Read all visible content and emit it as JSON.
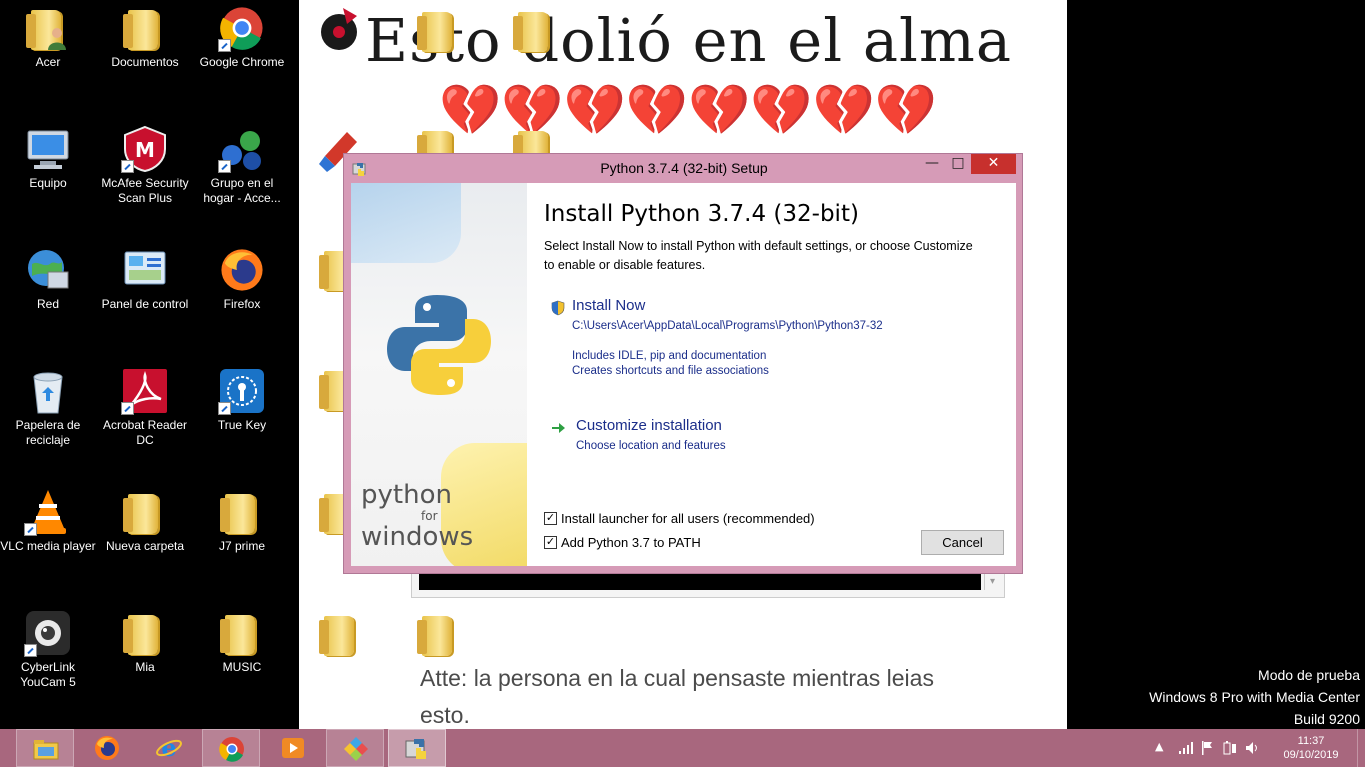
{
  "wallpaper": {
    "title": "Esto dolió en el alma",
    "hearts": "💔💔💔💔💔💔💔💔",
    "message": "Atte: la persona en la cual pensaste mientras leias esto."
  },
  "desktop_icons": [
    {
      "label": "Acer",
      "icon": "user-folder-icon"
    },
    {
      "label": "Documentos",
      "icon": "folder-icon"
    },
    {
      "label": "Google Chrome",
      "icon": "chrome-icon"
    },
    {
      "label": "Equipo",
      "icon": "computer-icon"
    },
    {
      "label": "McAfee Security Scan Plus",
      "icon": "mcafee-icon"
    },
    {
      "label": "Grupo en el hogar - Acce...",
      "icon": "homegroup-icon"
    },
    {
      "label": "Red",
      "icon": "network-icon"
    },
    {
      "label": "Panel de control",
      "icon": "control-panel-icon"
    },
    {
      "label": "Firefox",
      "icon": "firefox-icon"
    },
    {
      "label": "Papelera de reciclaje",
      "icon": "recycle-bin-icon"
    },
    {
      "label": "Acrobat Reader DC",
      "icon": "acrobat-icon"
    },
    {
      "label": "True Key",
      "icon": "truekey-icon"
    },
    {
      "label": "VLC media player",
      "icon": "vlc-icon"
    },
    {
      "label": "Nueva carpeta",
      "icon": "folder-icon"
    },
    {
      "label": "J7 prime",
      "icon": "folder-icon"
    },
    {
      "label": "CyberLink YouCam 5",
      "icon": "webcam-icon"
    },
    {
      "label": "Mia",
      "icon": "folder-icon"
    },
    {
      "label": "MUSIC",
      "icon": "folder-icon"
    }
  ],
  "dialog": {
    "title": "Python 3.7.4 (32-bit) Setup",
    "heading": "Install Python 3.7.4 (32-bit)",
    "description": "Select Install Now to install Python with default settings, or choose Customize to enable or disable features.",
    "install_now": {
      "label": "Install Now",
      "path": "C:\\Users\\Acer\\AppData\\Local\\Programs\\Python\\Python37-32",
      "line1": "Includes IDLE, pip and documentation",
      "line2": "Creates shortcuts and file associations"
    },
    "customize": {
      "label": "Customize installation",
      "sub": "Choose location and features"
    },
    "checkbox_launcher": {
      "label": "Install launcher for all users (recommended)",
      "checked": true
    },
    "checkbox_path": {
      "label": "Add Python 3.7 to PATH",
      "checked": true
    },
    "cancel_label": "Cancel",
    "brand_python": "python",
    "brand_for": "for",
    "brand_windows": "windows",
    "min_glyph": "—",
    "max_glyph": "□",
    "close_glyph": "✕",
    "check_glyph": "✓"
  },
  "watermark": {
    "line1": "Modo de prueba",
    "line2": "Windows 8 Pro with Media Center",
    "line3": "Build 9200"
  },
  "taskbar": {
    "apps": [
      {
        "name": "file-explorer-icon",
        "state": "running"
      },
      {
        "name": "firefox-icon",
        "state": "normal"
      },
      {
        "name": "internet-explorer-icon",
        "state": "normal"
      },
      {
        "name": "chrome-icon",
        "state": "running"
      },
      {
        "name": "media-player-icon",
        "state": "normal"
      },
      {
        "name": "colorful-app-icon",
        "state": "running"
      },
      {
        "name": "python-installer-icon",
        "state": "active"
      }
    ],
    "time": "11:37",
    "date": "09/10/2019"
  },
  "colors": {
    "taskbar": "#a8677e",
    "window_frame": "#d69bb7",
    "link_text": "#1b2e8a",
    "close_button": "#c7302d"
  }
}
